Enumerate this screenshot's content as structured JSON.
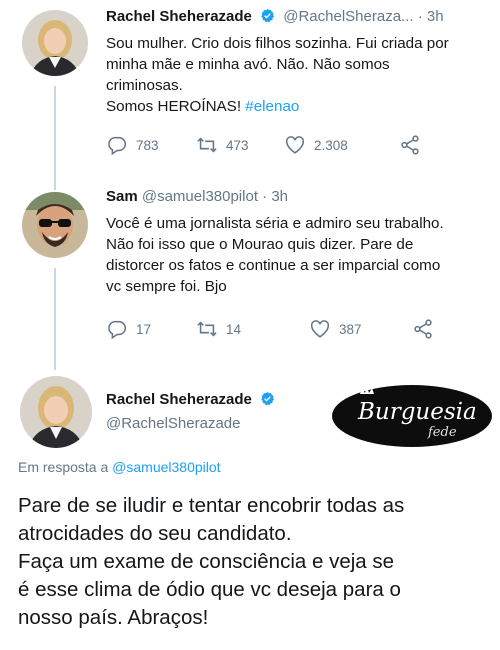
{
  "tweets": [
    {
      "author_name": "Rachel Sheherazade",
      "handle": "@RachelSheraza...",
      "time": "· 3h",
      "text_lines": [
        "Sou mulher. Crio dois filhos sozinha. Fui criada por",
        "minha mãe e minha avó. Não. Não somos",
        "criminosas."
      ],
      "last_line_text": "Somos HEROÍNAS!",
      "hashtag": "#elenao",
      "replies": "783",
      "retweets": "473",
      "likes": "2.308"
    },
    {
      "author_name": "Sam",
      "handle": "@samuel380pilot",
      "time": "· 3h",
      "text_lines": [
        "Você é uma jornalista séria e admiro seu trabalho.",
        "Não foi isso que o Mourao quis dizer. Pare de",
        "distorcer os fatos e continue a ser imparcial como",
        "vc sempre foi. Bjo"
      ],
      "replies": "17",
      "retweets": "14",
      "likes": "387"
    }
  ],
  "focused_tweet": {
    "author_name": "Rachel Sheherazade",
    "handle": "@RachelSherazade",
    "reply_prefix": "Em resposta a",
    "reply_mention": "@samuel380pilot",
    "text_lines": [
      "Pare de se iludir e tentar encobrir todas as",
      "atrocidades do seu candidato.",
      "Faça um exame de consciência e veja se",
      "é esse clima de ódio que vc deseja para o",
      "nosso país. Abraços!"
    ]
  },
  "watermark": {
    "line1": "Burguesia",
    "line2": "fede"
  },
  "icons": {
    "reply": "reply-icon",
    "retweet": "retweet-icon",
    "like": "heart-icon",
    "share": "share-icon",
    "verified": "verified-badge-icon"
  },
  "colors": {
    "link": "#1da1f2",
    "muted": "#657786",
    "text": "#14171a",
    "verified": "#1da1f2"
  }
}
